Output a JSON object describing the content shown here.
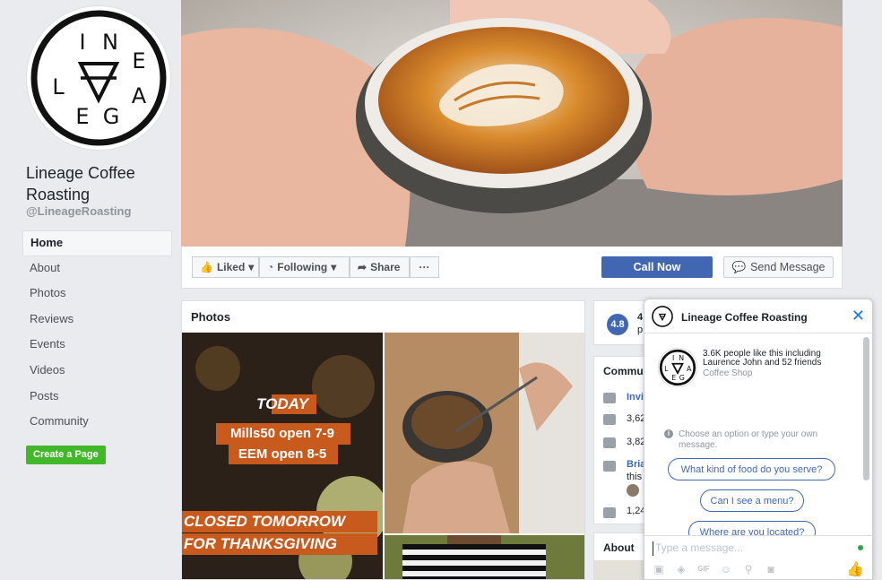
{
  "profile": {
    "name": "Lineage Coffee Roasting",
    "handle": "@LineageRoasting",
    "logo_letters": [
      "L",
      "I",
      "N",
      "E",
      "A",
      "G",
      "E"
    ]
  },
  "nav": [
    {
      "label": "Home",
      "active": true
    },
    {
      "label": "About"
    },
    {
      "label": "Photos"
    },
    {
      "label": "Reviews"
    },
    {
      "label": "Events"
    },
    {
      "label": "Videos"
    },
    {
      "label": "Posts"
    },
    {
      "label": "Community"
    }
  ],
  "create_page_label": "Create a Page",
  "actions": {
    "liked": "Liked",
    "following": "Following",
    "share": "Share",
    "more": "···",
    "call_now": "Call Now",
    "send_message": "Send Message"
  },
  "photos": {
    "title": "Photos",
    "promo_lines": [
      "TODAY",
      "Mills50 open 7-9",
      "EEM open 8-5",
      "CLOSED TOMORROW",
      "FOR THANKSGIVING"
    ]
  },
  "right_cards": {
    "rating": "4.8",
    "rating_snip": "4",
    "rating_snip2": "p",
    "community_title": "Commu",
    "rows": [
      "Invi",
      "3,62",
      "3,82",
      "Bria",
      "this",
      "1,24"
    ],
    "about_title": "About"
  },
  "chat": {
    "title": "Lineage Coffee Roasting",
    "likes_line1": "3.6K people like this including",
    "likes_line2": "Laurence John and 52 friends",
    "category": "Coffee Shop",
    "prompt_line1": "Choose an option or type your own",
    "prompt_line2": "message.",
    "quick_replies": [
      "What kind of food do you serve?",
      "Can I see a menu?",
      "Where are you located?"
    ],
    "input_placeholder": "Type a message..."
  },
  "colors": {
    "brand_blue": "#4267b2",
    "green": "#42b72a",
    "bg": "#e9ebee"
  }
}
